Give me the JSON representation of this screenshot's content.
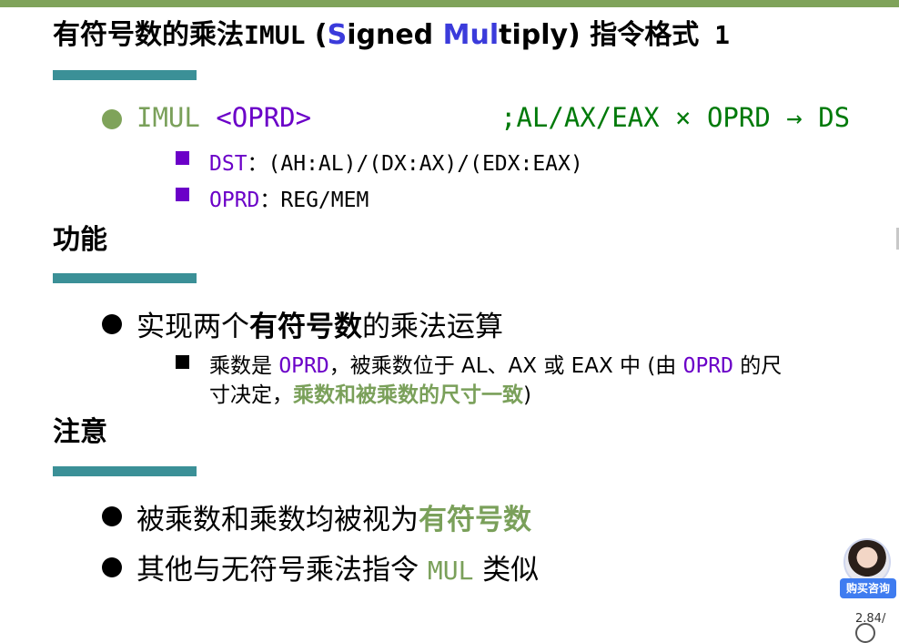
{
  "title": {
    "cn_prefix": "有符号数的乘法",
    "mnemonic": "IMUL",
    "paren_open": " (",
    "s_letter": "S",
    "ig": "i",
    "gned": "gned ",
    "mul": "Mul",
    "tiply": "tiply)",
    "cn_suffix": " 指令格式",
    "number": " 1"
  },
  "syntax": {
    "instr": "IMUL",
    "operand": "<OPRD>",
    "comment": ";AL/AX/EAX × OPRD → DS",
    "sub_items": [
      {
        "name": "DST",
        "colon": "：",
        "value": "(AH:AL)/(DX:AX)/(EDX:EAX)"
      },
      {
        "name": "OPRD",
        "colon": "：",
        "value": "REG/MEM"
      }
    ]
  },
  "section_function": {
    "heading": "功能",
    "bullet_prefix": "实现两个",
    "bullet_bold": "有符号数",
    "bullet_suffix": "的乘法运算",
    "sub_line1_a": "乘数是 ",
    "sub_line1_oprd": "OPRD",
    "sub_line1_b": "，被乘数位于 AL、AX 或 EAX 中 (由 ",
    "sub_line1_oprd2": "OPRD",
    "sub_line1_c": " 的尺",
    "sub_line2_a": "寸决定，",
    "sub_line2_bold": "乘数和被乘数的尺寸一致",
    "sub_line2_b": ")"
  },
  "section_note": {
    "heading": "注意",
    "item1_prefix": "被乘数和乘数均被视为",
    "item1_bold": "有符号数",
    "item2_prefix": "其他与无符号乘法指令 ",
    "item2_mono": "MUL",
    "item2_suffix": " 类似"
  },
  "widget": {
    "badge": "购买咨询",
    "corner_text": "2.84/"
  },
  "colors": {
    "top_bar": "#7fa35a",
    "underline": "#3b9097",
    "accent_green": "#7aa05a",
    "dark_green": "#007a0a",
    "purple": "#6b00c8",
    "blue": "#3b3bdb"
  }
}
